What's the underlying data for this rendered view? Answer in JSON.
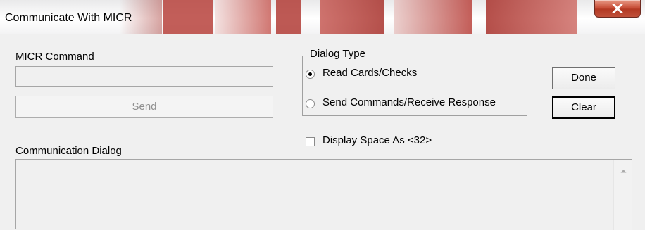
{
  "window": {
    "title": "Communicate With MICR",
    "close_icon": "close-icon",
    "accent": "#c8503a"
  },
  "micr": {
    "command_label": "MICR Command",
    "command_value": "",
    "send_label": "Send"
  },
  "dialog_type": {
    "title": "Dialog Type",
    "options": [
      {
        "label": "Read Cards/Checks",
        "selected": true
      },
      {
        "label": "Send Commands/Receive Response",
        "selected": false
      }
    ]
  },
  "buttons": {
    "done_label": "Done",
    "clear_label": "Clear"
  },
  "display_space": {
    "label": "Display Space As <32>",
    "checked": false
  },
  "communication": {
    "label": "Communication Dialog",
    "content": ""
  }
}
